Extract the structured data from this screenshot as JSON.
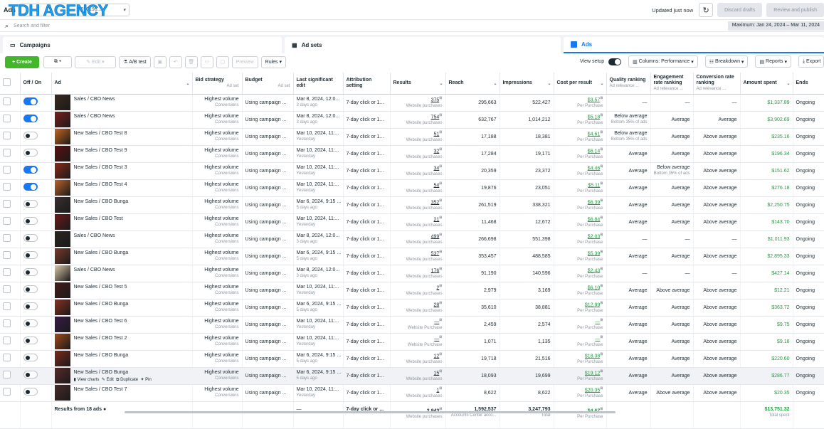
{
  "topbar": {
    "ads_label": "Ads",
    "account_text": "(760198...)",
    "logo_text": "TDH AGENCY",
    "updated": "Updated just now",
    "discard": "Discard drafts",
    "review": "Review and publish"
  },
  "search": {
    "placeholder": "Search and filter",
    "date_range": "Maximum: Jan 24, 2024 – Mar 11, 2024"
  },
  "tabs": [
    {
      "label": "Campaigns",
      "icon": "folder-icon"
    },
    {
      "label": "Ad sets",
      "icon": "grid-icon"
    },
    {
      "label": "Ads",
      "icon": "ad-icon"
    }
  ],
  "toolbar": {
    "create": "+ Create",
    "edit": "Edit",
    "ab_test": "A/B test",
    "preview": "Preview",
    "rules": "Rules",
    "view_setup": "View setup",
    "columns": "Columns: Performance",
    "breakdown": "Breakdown",
    "reports": "Reports",
    "export": "Export"
  },
  "columns": [
    {
      "label": "Off / On",
      "sub": ""
    },
    {
      "label": "Ad",
      "sub": ""
    },
    {
      "label": "Bid strategy",
      "sub": "Ad set"
    },
    {
      "label": "Budget",
      "sub": "Ad set"
    },
    {
      "label": "Last significant edit",
      "sub": ""
    },
    {
      "label": "Attribution setting",
      "sub": ""
    },
    {
      "label": "Results",
      "sub": ""
    },
    {
      "label": "Reach",
      "sub": ""
    },
    {
      "label": "Impressions",
      "sub": ""
    },
    {
      "label": "Cost per result",
      "sub": ""
    },
    {
      "label": "Quality ranking",
      "sub": "Ad relevance ..."
    },
    {
      "label": "Engagement rate ranking",
      "sub": "Ad relevance ..."
    },
    {
      "label": "Conversion rate ranking",
      "sub": "Ad relevance ..."
    },
    {
      "label": "Amount spent",
      "sub": ""
    },
    {
      "label": "Ends",
      "sub": ""
    }
  ],
  "rows": [
    {
      "on": true,
      "name": "Sales / CBO News",
      "bid": "Highest volume",
      "bidsub": "Conversions",
      "budget": "Using campaign ...",
      "edit": "Mar 8, 2024, 12:0...",
      "editsub": "3 days ago",
      "attr": "7-day click or 1...",
      "results": "375",
      "ressub": "Website purchases",
      "reach": "295,663",
      "impr": "522,427",
      "cpr": "$3.57",
      "cprsub": "Per Purchase",
      "q": "—",
      "qsub": "",
      "e": "—",
      "esub": "",
      "c": "—",
      "spent": "$1,337.89",
      "ends": "Ongoing",
      "thumb": "#3a2a1e"
    },
    {
      "on": true,
      "name": "Sales / CBO News",
      "bid": "Highest volume",
      "bidsub": "Conversions",
      "budget": "Using campaign ...",
      "edit": "Mar 8, 2024, 12:0...",
      "editsub": "3 days ago",
      "attr": "7-day click or 1...",
      "results": "754",
      "ressub": "Website purchases",
      "reach": "632,767",
      "impr": "1,014,212",
      "cpr": "$5.18",
      "cprsub": "Per Purchase",
      "q": "Below average",
      "qsub": "Bottom 35% of ads",
      "e": "Average",
      "esub": "",
      "c": "Average",
      "spent": "$3,902.69",
      "ends": "Ongoing",
      "thumb": "#7a1e1e"
    },
    {
      "on": false,
      "name": "New Sales / CBO Test 8",
      "bid": "Highest volume",
      "bidsub": "Conversions",
      "budget": "Using campaign ...",
      "edit": "Mar 10, 2024, 11:...",
      "editsub": "Yesterday",
      "attr": "7-day click or 1...",
      "results": "51",
      "ressub": "Website purchases",
      "reach": "17,188",
      "impr": "18,381",
      "cpr": "$4.61",
      "cprsub": "Per Purchase",
      "q": "Below average",
      "qsub": "Bottom 35% of ads",
      "e": "Average",
      "esub": "",
      "c": "Above average",
      "spent": "$235.16",
      "ends": "Ongoing",
      "thumb": "#c4661f"
    },
    {
      "on": false,
      "name": "New Sales / CBO Test 9",
      "bid": "Highest volume",
      "bidsub": "Conversions",
      "budget": "Using campaign ...",
      "edit": "Mar 10, 2024, 11:...",
      "editsub": "Yesterday",
      "attr": "7-day click or 1...",
      "results": "32",
      "ressub": "Website purchases",
      "reach": "17,284",
      "impr": "19,171",
      "cpr": "$6.14",
      "cprsub": "Per Purchase",
      "q": "Average",
      "qsub": "",
      "e": "Average",
      "esub": "",
      "c": "Above average",
      "spent": "$196.34",
      "ends": "Ongoing",
      "thumb": "#5a1010"
    },
    {
      "on": true,
      "name": "New Sales / CBO Test 3",
      "bid": "Highest volume",
      "bidsub": "Conversions",
      "budget": "Using campaign ...",
      "edit": "Mar 10, 2024, 11:...",
      "editsub": "Yesterday",
      "attr": "7-day click or 1...",
      "results": "34",
      "ressub": "Website purchases",
      "reach": "20,359",
      "impr": "23,372",
      "cpr": "$4.46",
      "cprsub": "Per Purchase",
      "q": "Average",
      "qsub": "",
      "e": "Below average",
      "esub": "Bottom 35% of ads",
      "c": "Above average",
      "spent": "$151.62",
      "ends": "Ongoing",
      "thumb": "#8a2a14"
    },
    {
      "on": true,
      "name": "New Sales / CBO Test 4",
      "bid": "Highest volume",
      "bidsub": "Conversions",
      "budget": "Using campaign ...",
      "edit": "Mar 10, 2024, 11:...",
      "editsub": "Yesterday",
      "attr": "7-day click or 1...",
      "results": "54",
      "ressub": "Website purchases",
      "reach": "19,876",
      "impr": "23,051",
      "cpr": "$5.11",
      "cprsub": "Per Purchase",
      "q": "Average",
      "qsub": "",
      "e": "Average",
      "esub": "",
      "c": "Above average",
      "spent": "$276.18",
      "ends": "Ongoing",
      "thumb": "#b8632a"
    },
    {
      "on": false,
      "name": "New Sales / CBO Bunga",
      "bid": "Highest volume",
      "bidsub": "Conversions",
      "budget": "Using campaign ...",
      "edit": "Mar 6, 2024, 9:15 ...",
      "editsub": "5 days ago",
      "attr": "7-day click or 1...",
      "results": "352",
      "ressub": "Website purchases",
      "reach": "261,519",
      "impr": "338,321",
      "cpr": "$6.39",
      "cprsub": "Per Purchase",
      "q": "Average",
      "qsub": "",
      "e": "Average",
      "esub": "",
      "c": "Above average",
      "spent": "$2,250.75",
      "ends": "Ongoing",
      "thumb": "#3a3030"
    },
    {
      "on": false,
      "name": "New Sales / CBO Test",
      "bid": "Highest volume",
      "bidsub": "Conversions",
      "budget": "Using campaign ...",
      "edit": "Mar 10, 2024, 11:...",
      "editsub": "Yesterday",
      "attr": "7-day click or 1...",
      "results": "21",
      "ressub": "Website purchases",
      "reach": "11,468",
      "impr": "12,672",
      "cpr": "$6.84",
      "cprsub": "Per Purchase",
      "q": "Average",
      "qsub": "",
      "e": "Average",
      "esub": "",
      "c": "Above average",
      "spent": "$143.70",
      "ends": "Ongoing",
      "thumb": "#6a1a1a"
    },
    {
      "on": false,
      "name": "Sales / CBO News",
      "bid": "Highest volume",
      "bidsub": "Conversions",
      "budget": "Using campaign ...",
      "edit": "Mar 8, 2024, 12:0...",
      "editsub": "3 days ago",
      "attr": "7-day click or 1...",
      "results": "499",
      "ressub": "Website purchases",
      "reach": "266,698",
      "impr": "551,398",
      "cpr": "$2.03",
      "cprsub": "Per Purchase",
      "q": "—",
      "qsub": "",
      "e": "—",
      "esub": "",
      "c": "—",
      "spent": "$1,011.93",
      "ends": "Ongoing",
      "thumb": "#2a2420"
    },
    {
      "on": false,
      "name": "New Sales / CBO Bunga",
      "bid": "Highest volume",
      "bidsub": "Conversions",
      "budget": "Using campaign ...",
      "edit": "Mar 6, 2024, 9:15 ...",
      "editsub": "5 days ago",
      "attr": "7-day click or 1...",
      "results": "537",
      "ressub": "Website purchases",
      "reach": "353,457",
      "impr": "488,585",
      "cpr": "$5.39",
      "cprsub": "Per Purchase",
      "q": "Average",
      "qsub": "",
      "e": "Average",
      "esub": "",
      "c": "Above average",
      "spent": "$2,895.33",
      "ends": "Ongoing",
      "thumb": "#7a3a2a"
    },
    {
      "on": false,
      "name": "Sales / CBO News",
      "bid": "Highest volume",
      "bidsub": "Conversions",
      "budget": "Using campaign ...",
      "edit": "Mar 8, 2024, 12:0...",
      "editsub": "3 days ago",
      "attr": "7-day click or 1...",
      "results": "176",
      "ressub": "Website purchases",
      "reach": "91,190",
      "impr": "140,596",
      "cpr": "$2.43",
      "cprsub": "Per Purchase",
      "q": "—",
      "qsub": "",
      "e": "—",
      "esub": "",
      "c": "—",
      "spent": "$427.14",
      "ends": "Ongoing",
      "thumb": "#d8c8a8"
    },
    {
      "on": false,
      "name": "New Sales / CBO Test 5",
      "bid": "Highest volume",
      "bidsub": "Conversions",
      "budget": "Using campaign ...",
      "edit": "Mar 10, 2024, 11:...",
      "editsub": "Yesterday",
      "attr": "7-day click or 1...",
      "results": "2",
      "ressub": "Website purchases",
      "reach": "2,979",
      "impr": "3,169",
      "cpr": "$6.10",
      "cprsub": "Per Purchase",
      "q": "Average",
      "qsub": "",
      "e": "Above average",
      "esub": "",
      "c": "Above average",
      "spent": "$12.21",
      "ends": "Ongoing",
      "thumb": "#4a1a1a"
    },
    {
      "on": false,
      "name": "New Sales / CBO Bunga",
      "bid": "Highest volume",
      "bidsub": "Conversions",
      "budget": "Using campaign ...",
      "edit": "Mar 6, 2024, 9:15 ...",
      "editsub": "5 days ago",
      "attr": "7-day click or 1...",
      "results": "28",
      "ressub": "Website purchases",
      "reach": "35,610",
      "impr": "38,881",
      "cpr": "$12.99",
      "cprsub": "Per Purchase",
      "q": "Average",
      "qsub": "",
      "e": "Average",
      "esub": "",
      "c": "Above average",
      "spent": "$363.72",
      "ends": "Ongoing",
      "thumb": "#8a3020"
    },
    {
      "on": false,
      "name": "New Sales / CBO Test 6",
      "bid": "Highest volume",
      "bidsub": "Conversions",
      "budget": "Using campaign ...",
      "edit": "Mar 10, 2024, 11:...",
      "editsub": "Yesterday",
      "attr": "7-day click or 1...",
      "results": "—",
      "ressub": "Website Purchase",
      "reach": "2,459",
      "impr": "2,574",
      "cpr": "—",
      "cprsub": "Per Purchase",
      "q": "Average",
      "qsub": "",
      "e": "Average",
      "esub": "",
      "c": "Above average",
      "spent": "$9.75",
      "ends": "Ongoing",
      "thumb": "#3a1a4a"
    },
    {
      "on": false,
      "name": "New Sales / CBO Test 2",
      "bid": "Highest volume",
      "bidsub": "Conversions",
      "budget": "Using campaign ...",
      "edit": "Mar 10, 2024, 11:...",
      "editsub": "Yesterday",
      "attr": "7-day click or 1...",
      "results": "—",
      "ressub": "Website Purchase",
      "reach": "1,071",
      "impr": "1,135",
      "cpr": "—",
      "cprsub": "Per Purchase",
      "q": "Average",
      "qsub": "",
      "e": "Average",
      "esub": "",
      "c": "Above average",
      "spent": "$9.18",
      "ends": "Ongoing",
      "thumb": "#a04a1a"
    },
    {
      "on": false,
      "name": "New Sales / CBO Bunga",
      "bid": "Highest volume",
      "bidsub": "Conversions",
      "budget": "Using campaign ...",
      "edit": "Mar 6, 2024, 9:15 ...",
      "editsub": "5 days ago",
      "attr": "7-day click or 1...",
      "results": "12",
      "ressub": "Website purchases",
      "reach": "19,718",
      "impr": "21,516",
      "cpr": "$18.38",
      "cprsub": "Per Purchase",
      "q": "Average",
      "qsub": "",
      "e": "Average",
      "esub": "",
      "c": "Above average",
      "spent": "$220.60",
      "ends": "Ongoing",
      "thumb": "#7a2a1a"
    },
    {
      "on": false,
      "name": "New Sales / CBO Bunga",
      "bid": "Highest volume",
      "bidsub": "Conversions",
      "budget": "Using campaign ...",
      "edit": "Mar 6, 2024, 9:15 ...",
      "editsub": "5 days ago",
      "attr": "7-day click or 1...",
      "results": "15",
      "ressub": "Website purchases",
      "reach": "18,093",
      "impr": "19,699",
      "cpr": "$19.12",
      "cprsub": "Per Purchase",
      "q": "Average",
      "qsub": "",
      "e": "Average",
      "esub": "",
      "c": "Above average",
      "spent": "$286.77",
      "ends": "Ongoing",
      "thumb": "#5a2a2a",
      "hover": true
    },
    {
      "on": false,
      "name": "New Sales / CBO Test 7",
      "bid": "Highest volume",
      "bidsub": "Conversions",
      "budget": "Using campaign ...",
      "edit": "Mar 10, 2024, 11:...",
      "editsub": "Yesterday",
      "attr": "7-day click or 1...",
      "results": "1",
      "ressub": "Website purchases",
      "reach": "8,622",
      "impr": "8,622",
      "cpr": "$20.35",
      "cprsub": "Per Purchase",
      "q": "Average",
      "qsub": "",
      "e": "Above average",
      "esub": "",
      "c": "Above average",
      "spent": "$20.35",
      "ends": "Ongoing",
      "thumb": "#4a2a2a"
    }
  ],
  "hover_actions": {
    "charts": "View charts",
    "edit": "Edit",
    "duplicate": "Duplicate",
    "pin": "Pin"
  },
  "footer": {
    "label": "Results from 18 ads",
    "edit": "—",
    "attr": "7-day click or ...",
    "results": "2,943",
    "ressub": "Website purchases",
    "reach": "1,592,537",
    "reachsub": "Accounts Center acco...",
    "impr": "3,247,793",
    "imprsub": "Total",
    "cpr": "$4.67",
    "cprsub": "Per Purchase",
    "spent": "$13,751.32",
    "spentsub": "Total spent"
  },
  "colors": {
    "accent": "#1877f2",
    "create": "#42b72a",
    "money": "#1f9d3d"
  }
}
